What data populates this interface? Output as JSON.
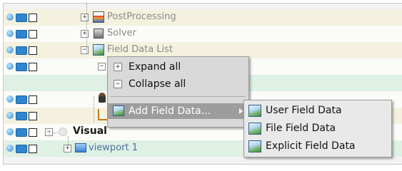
{
  "tree": {
    "rows": [
      {
        "label": "PostProcessing",
        "icon": "postprocessing-icon",
        "toggle": "+"
      },
      {
        "label": "Solver",
        "icon": "solver-icon",
        "toggle": "+"
      },
      {
        "label": "Field Data List",
        "icon": "field-data-list-icon",
        "toggle": "−"
      },
      {
        "label": "",
        "icon": "",
        "toggle": "−"
      },
      {
        "label": "",
        "icon": "",
        "toggle": ""
      },
      {
        "label": "",
        "icon": "person-icon",
        "toggle": ""
      },
      {
        "label": "",
        "icon": "chair-icon",
        "toggle": ""
      },
      {
        "label": "Visual",
        "icon": "visual-icon",
        "toggle": "−"
      },
      {
        "label": "viewport 1",
        "icon": "viewport-icon",
        "toggle": "+"
      }
    ]
  },
  "context_menu": {
    "items": [
      {
        "label": "Expand all",
        "icon": "expand-icon",
        "glyph": "+"
      },
      {
        "label": "Collapse all",
        "icon": "collapse-icon",
        "glyph": "−"
      },
      {
        "label": "Add Field Data...",
        "icon": "field-data-icon",
        "glyph": ""
      }
    ]
  },
  "submenu": {
    "items": [
      {
        "label": "User Field Data"
      },
      {
        "label": "File Field Data"
      },
      {
        "label": "Explicit Field Data"
      }
    ]
  },
  "colors": {
    "menu_highlight": "#9d9d9d",
    "row_selected": "#dff0e4",
    "row_yellow": "#f4f2df"
  }
}
